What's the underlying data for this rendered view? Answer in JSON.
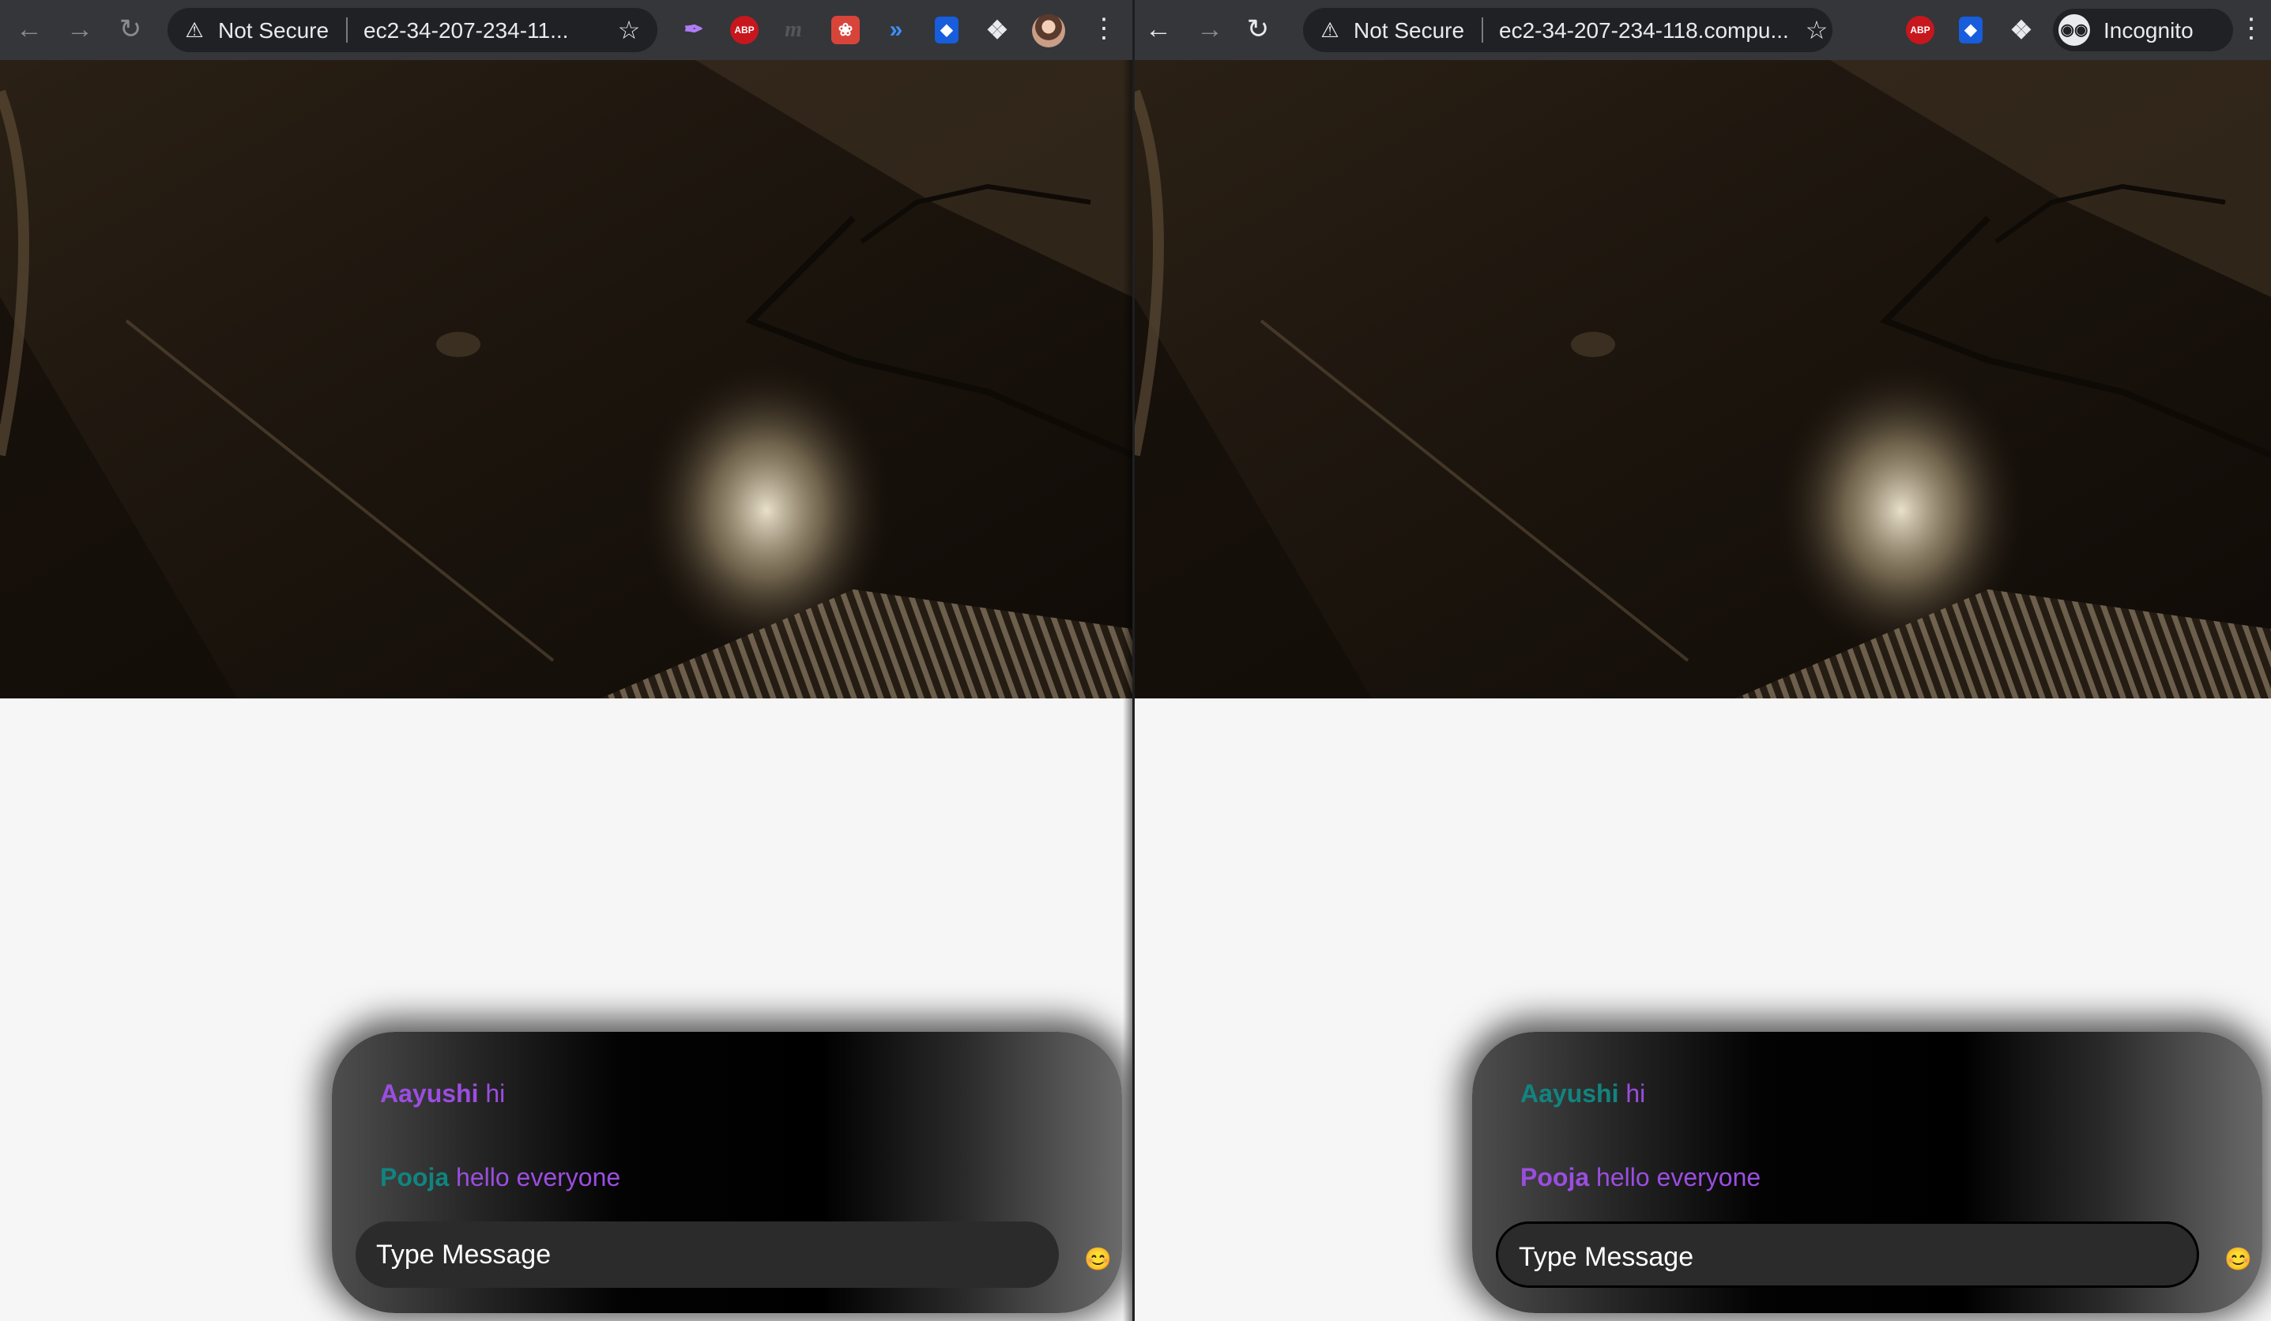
{
  "windows": [
    {
      "omnibox": {
        "security_label": "Not Secure",
        "url_text": "ec2-34-207-234-11..."
      },
      "icons": {
        "back": "arrow-left-icon",
        "forward": "arrow-right-icon",
        "reload": "reload-icon",
        "warning": "warning-icon",
        "bookmark": "star-icon"
      },
      "extensions": [
        {
          "name": "feather-extension-icon",
          "glyph": "✒"
        },
        {
          "name": "adblock-plus-icon",
          "glyph": "ABP"
        },
        {
          "name": "m-extension-icon",
          "glyph": "m"
        },
        {
          "name": "red-extension-icon",
          "glyph": "❀"
        },
        {
          "name": "chevrons-extension-icon",
          "glyph": "»"
        },
        {
          "name": "bitwarden-shield-icon",
          "glyph": "◆"
        },
        {
          "name": "extensions-puzzle-icon",
          "glyph": "❖"
        }
      ],
      "chat": {
        "messages": [
          {
            "sender": "Aayushi",
            "text": "hi",
            "sender_color": "#9b4de0",
            "text_color": "#9b4de0"
          },
          {
            "sender": "Pooja",
            "text": "hello everyone",
            "sender_color": "#11847f",
            "text_color": "#9b4de0"
          }
        ],
        "input": {
          "placeholder": "Type Message",
          "focused": false
        },
        "emoji": "😊"
      }
    },
    {
      "omnibox": {
        "security_label": "Not Secure",
        "url_text": "ec2-34-207-234-118.compu..."
      },
      "icons": {
        "back": "arrow-left-icon",
        "forward": "arrow-right-icon",
        "reload": "reload-icon",
        "warning": "warning-icon",
        "bookmark": "star-icon"
      },
      "extensions": [
        {
          "name": "adblock-plus-icon",
          "glyph": "ABP"
        },
        {
          "name": "bitwarden-shield-icon",
          "glyph": "◆"
        },
        {
          "name": "extensions-puzzle-icon",
          "glyph": "❖"
        }
      ],
      "incognito": {
        "label": "Incognito",
        "icon": "incognito-icon"
      },
      "chat": {
        "messages": [
          {
            "sender": "Aayushi",
            "text": "hi",
            "sender_color": "#11847f",
            "text_color": "#9b4de0"
          },
          {
            "sender": "Pooja",
            "text": "hello everyone",
            "sender_color": "#9b4de0",
            "text_color": "#9b4de0"
          }
        ],
        "input": {
          "placeholder": "Type Message",
          "focused": true
        },
        "emoji": "😊"
      }
    }
  ],
  "colors": {
    "toolbar": "#35363a",
    "omnibox": "#202124",
    "page_background": "#f6f6f6",
    "accent_purple": "#9b4de0",
    "accent_teal": "#11847f"
  }
}
